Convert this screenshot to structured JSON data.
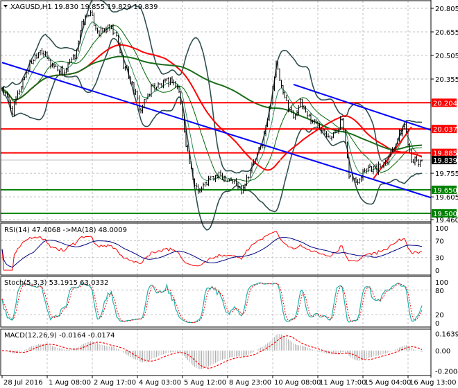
{
  "chart_data": {
    "type": "ohlc",
    "symbol": "XAGUSD,H1",
    "ohlc_text": "19.830 19.855 19.829 19.839",
    "price_axis": {
      "min": 19.46,
      "max": 20.805,
      "ticks": [
        "20.805",
        "20.655",
        "20.505",
        "20.355",
        "19.755",
        "19.605",
        "19.460"
      ]
    },
    "time_labels": [
      "28 Jul 2016",
      "1 Aug 08:00",
      "2 Aug 17:00",
      "4 Aug 03:00",
      "5 Aug 12:00",
      "8 Aug 23:00",
      "10 Aug 08:00",
      "11 Aug 17:00",
      "15 Aug 04:00",
      "16 Aug 13:00"
    ],
    "time_label_bars": [
      0,
      26,
      52,
      78,
      104,
      130,
      156,
      182,
      208,
      234
    ],
    "bar_count": 243,
    "close_keypoints": [
      [
        0,
        20.3
      ],
      [
        6,
        20.15
      ],
      [
        12,
        20.35
      ],
      [
        16,
        20.45
      ],
      [
        22,
        20.55
      ],
      [
        28,
        20.45
      ],
      [
        36,
        20.4
      ],
      [
        42,
        20.5
      ],
      [
        46,
        20.7
      ],
      [
        50,
        20.78
      ],
      [
        56,
        20.65
      ],
      [
        62,
        20.68
      ],
      [
        66,
        20.62
      ],
      [
        70,
        20.45
      ],
      [
        74,
        20.35
      ],
      [
        80,
        20.15
      ],
      [
        86,
        20.3
      ],
      [
        92,
        20.32
      ],
      [
        98,
        20.35
      ],
      [
        102,
        20.28
      ],
      [
        106,
        19.95
      ],
      [
        110,
        19.7
      ],
      [
        114,
        19.65
      ],
      [
        120,
        19.72
      ],
      [
        126,
        19.74
      ],
      [
        132,
        19.72
      ],
      [
        138,
        19.65
      ],
      [
        144,
        19.8
      ],
      [
        150,
        19.95
      ],
      [
        154,
        20.15
      ],
      [
        158,
        20.45
      ],
      [
        162,
        20.25
      ],
      [
        168,
        20.12
      ],
      [
        172,
        20.2
      ],
      [
        178,
        20.1
      ],
      [
        184,
        20.05
      ],
      [
        190,
        19.98
      ],
      [
        196,
        20.1
      ],
      [
        200,
        19.75
      ],
      [
        204,
        19.7
      ],
      [
        210,
        19.8
      ],
      [
        216,
        19.78
      ],
      [
        222,
        19.85
      ],
      [
        228,
        19.98
      ],
      [
        232,
        20.07
      ],
      [
        236,
        19.85
      ],
      [
        240,
        19.82
      ],
      [
        242,
        19.839
      ]
    ],
    "horizontal_levels": [
      {
        "label": "20.204",
        "value": 20.204,
        "color": "#ff0000"
      },
      {
        "label": "20.037",
        "value": 20.037,
        "color": "#ff0000"
      },
      {
        "label": "19.885",
        "value": 19.885,
        "color": "#ff0000"
      },
      {
        "label": "19.650",
        "value": 19.65,
        "color": "#008000"
      },
      {
        "label": "19.500",
        "value": 19.5,
        "color": "#008000"
      }
    ],
    "current_price": {
      "label": "19.839",
      "value": 19.839,
      "color": "#000000"
    },
    "trendlines": [
      {
        "name": "lower-channel",
        "from": [
          0,
          20.46
        ],
        "to": [
          248,
          19.6
        ],
        "color": "#0000ff"
      },
      {
        "name": "upper-channel",
        "from": [
          168,
          20.32
        ],
        "to": [
          248,
          20.03
        ],
        "color": "#0000ff"
      },
      {
        "name": "short-uptrend",
        "from": [
          214,
          19.72
        ],
        "to": [
          236,
          20.05
        ],
        "color": "#ff0000"
      }
    ],
    "indicators": {
      "rsi": {
        "label": "RSI(14) 47.4068  ->MA(18) 48.0009",
        "ticks": [
          "100",
          "70",
          "30",
          "0"
        ]
      },
      "stoch": {
        "label": "Stoch(5,3,3) 53.1915 63.0332",
        "ticks": [
          "100",
          "80",
          "20",
          "0"
        ]
      },
      "macd": {
        "label": "MACD(12,26,9) -0.0164 -0.0174",
        "ticks": [
          "0.1639",
          "0.00",
          "-0.2004"
        ]
      }
    }
  }
}
